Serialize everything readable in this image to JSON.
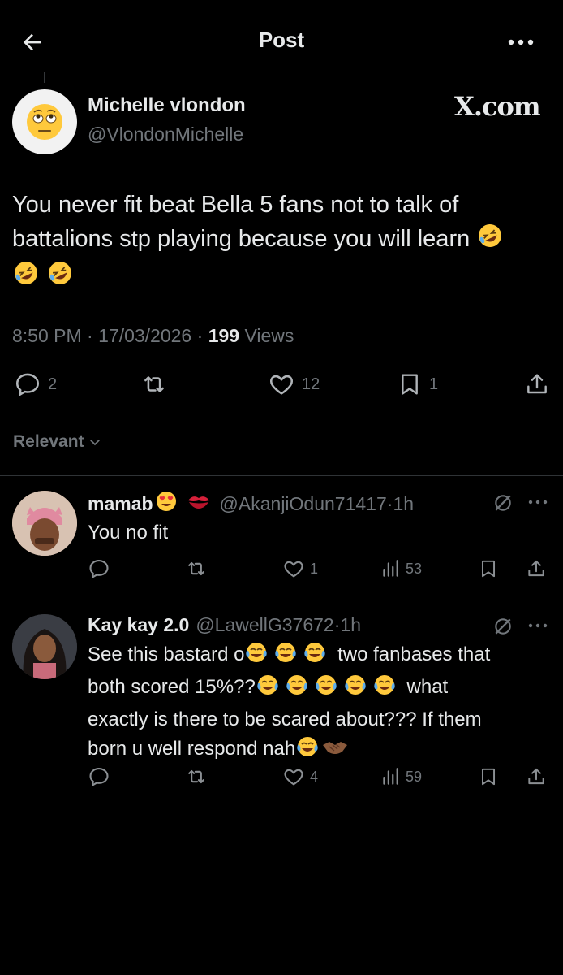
{
  "header": {
    "title": "Post"
  },
  "post": {
    "author_name": "Michelle vlondon",
    "author_handle": "@VlondonMichelle",
    "watermark": "X.com",
    "text": "You never fit beat Bella 5 fans not to talk of battalions stp playing because you will learn",
    "time": "8:50 PM",
    "date": "17/03/2026",
    "views_count": "199",
    "views_label": "Views",
    "replies": "2",
    "likes": "12",
    "bookmarks": "1"
  },
  "sort": {
    "label": "Relevant"
  },
  "replies": [
    {
      "name": "mamab",
      "handle": "@AkanjiOdun71417",
      "time": "1h",
      "text": "You no fit",
      "likes": "1",
      "views": "53"
    },
    {
      "name": "Kay kay 2.0",
      "handle": "@LawellG37672",
      "time": "1h",
      "text_line1": "See this bastard o",
      "text_line1b": "two fanbases that",
      "text_line2": "both scored 15%??",
      "text_line2b": "what",
      "text_line3": "exactly is there to be scared about??? If them",
      "text_line4": "born u well respond nah",
      "likes": "4",
      "views": "59"
    }
  ],
  "colors": {
    "background": "#000000",
    "text": "#e7e9ea",
    "secondary": "#71767b",
    "divider": "#2f3336"
  },
  "icons": [
    "back-arrow-icon",
    "more-icon",
    "reply-icon",
    "retweet-icon",
    "like-icon",
    "bookmark-icon",
    "share-icon",
    "chevron-down-icon",
    "grok-icon",
    "views-icon"
  ]
}
